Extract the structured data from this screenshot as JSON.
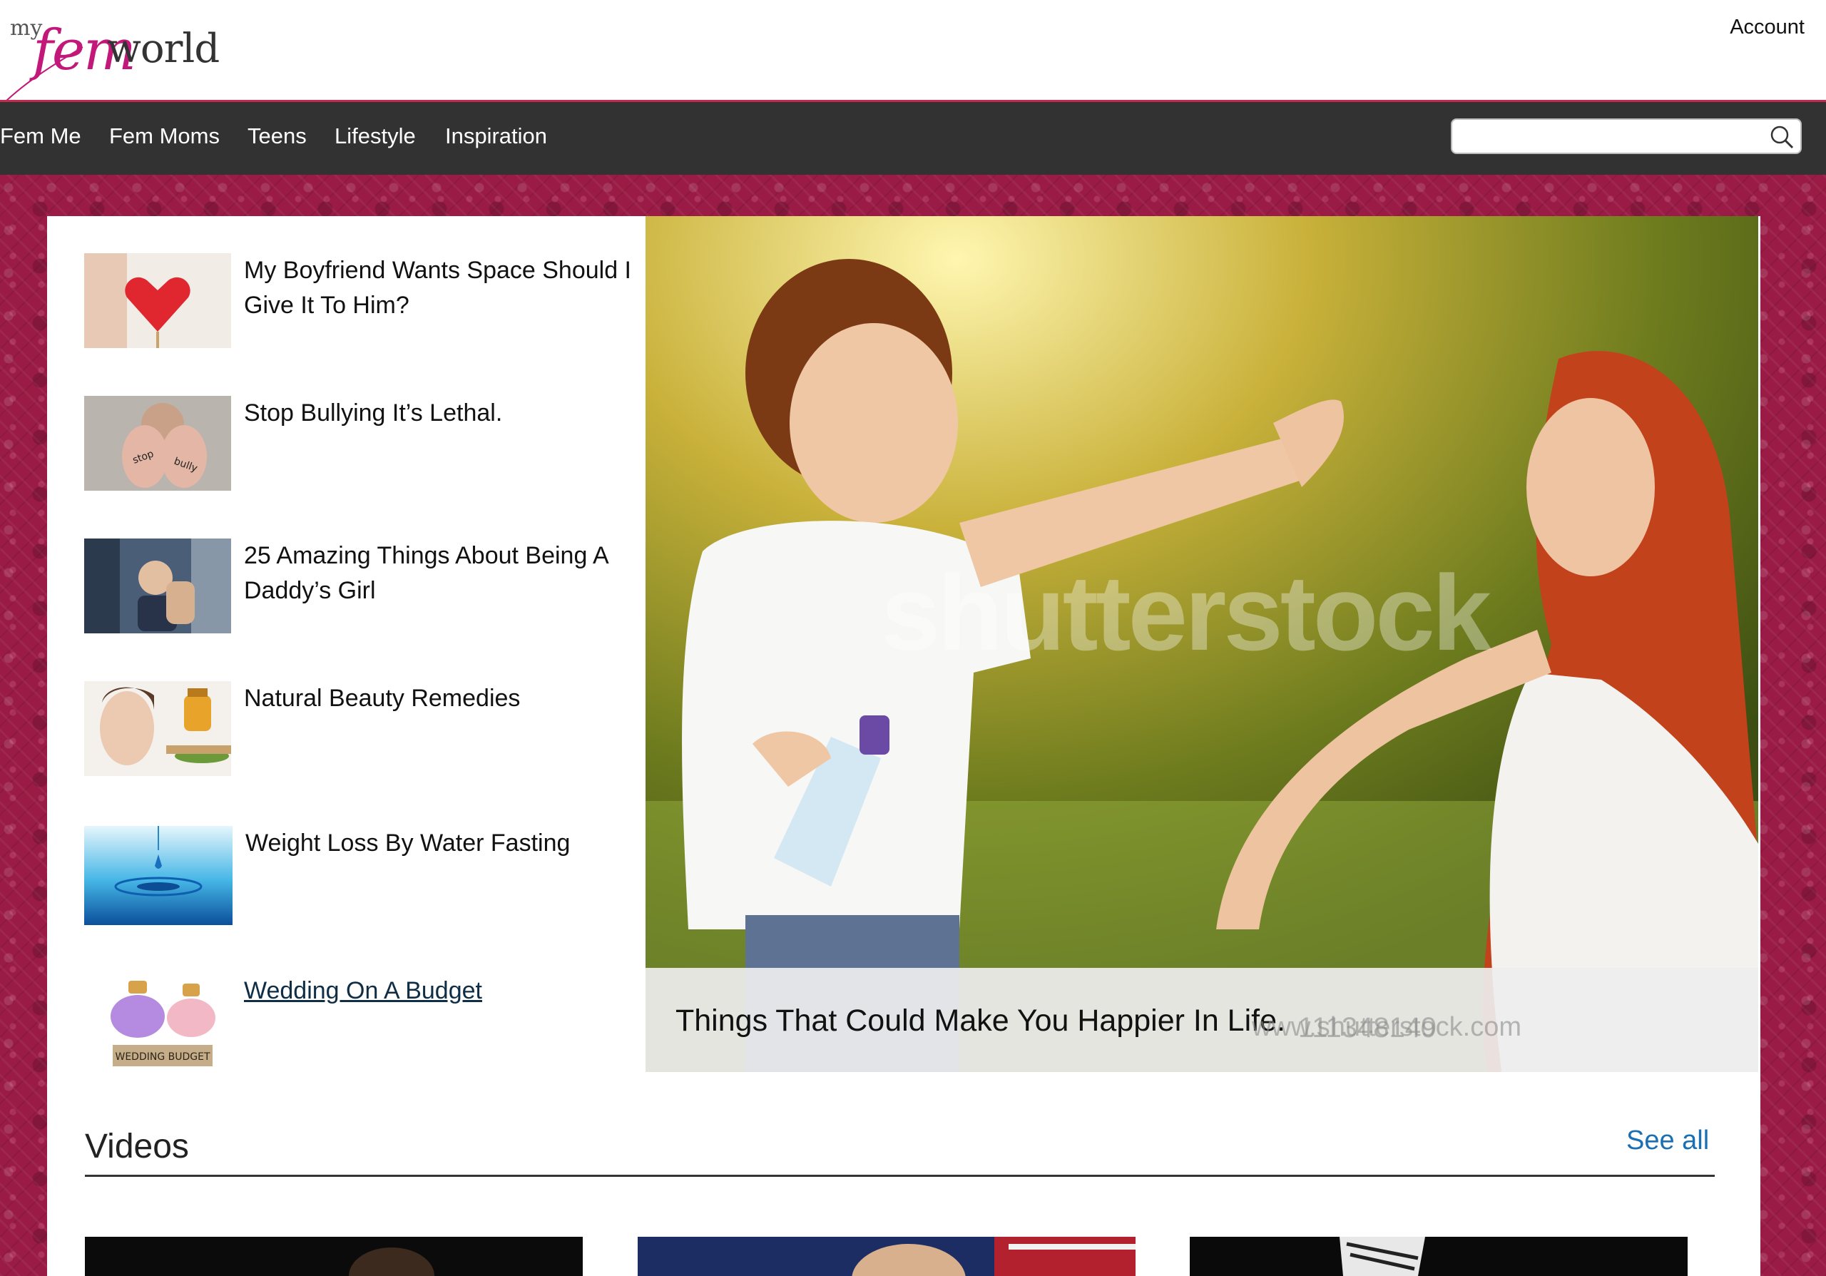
{
  "header": {
    "logo": {
      "my": "my",
      "fem": "fem",
      "world": "world"
    },
    "account_label": "Account"
  },
  "nav": {
    "items": [
      "Fem Me",
      "Fem Moms",
      "Teens",
      "Lifestyle",
      "Inspiration"
    ],
    "search_placeholder": ""
  },
  "articles": [
    {
      "title": "My Boyfriend Wants Space Should I Give It To Him?",
      "thumb": "heart-photo"
    },
    {
      "title": "Stop Bullying It’s Lethal.",
      "thumb": "stop-bullying-hands-photo"
    },
    {
      "title": "25 Amazing Things About Being A Daddy’s Girl",
      "thumb": "father-baby-photo"
    },
    {
      "title": "Natural Beauty Remedies",
      "thumb": "beauty-honey-photo"
    },
    {
      "title": "Weight Loss By Water Fasting",
      "thumb": "water-drop-photo"
    },
    {
      "title": "Wedding On A Budget",
      "thumb": "piggy-banks-photo",
      "thumb_label": "WEDDING BUDGET"
    }
  ],
  "hero": {
    "caption": "Things That Could Make You Happier In Life.",
    "watermark": "shutterstock",
    "watermark_id": "111348149",
    "watermark_url": "www.shutterstock.com"
  },
  "videos": {
    "title": "Videos",
    "see_all": "See all"
  },
  "colors": {
    "brand": "#c2187a",
    "nav_bg": "#323232",
    "page_bg": "#9a1b45",
    "link": "#1b6fb3"
  }
}
